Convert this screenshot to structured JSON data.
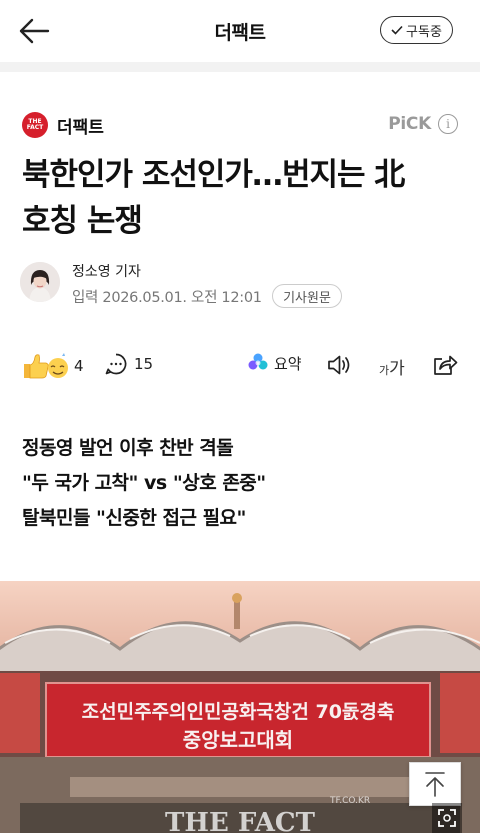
{
  "topbar": {
    "title": "더팩트",
    "subscribe_label": "구독중"
  },
  "press": {
    "name": "더팩트",
    "logo_text": "THE FACT",
    "pick_label": "PiCK"
  },
  "headline": {
    "line1": "북한인가 조선인가…번지는 北",
    "line2": "호칭 논쟁"
  },
  "author": {
    "name": "정소영 기자",
    "date": "입력 2026.05.01. 오전 12:01",
    "original_label": "기사원문"
  },
  "toolbar": {
    "reaction_count": "4",
    "comment_count": "15",
    "summary_label": "요약",
    "font_small": "가",
    "font_large": "가"
  },
  "subheads": [
    "정동영 발언 이후 찬반 격돌",
    "\"두 국가 고착\" vs \"상호 존중\"",
    "탈북민들 \"신중한 접근 필요\""
  ],
  "photo": {
    "banner_line1": "조선민주주의인민공화국창건 70돐경축",
    "banner_line2": "중앙보고대회",
    "watermark": "THE FACT",
    "watermark_site": "TF.CO.KR"
  },
  "colors": {
    "brand_red": "#d61f2c",
    "banner_red": "#c8262e",
    "muted": "#9a9a9a"
  }
}
